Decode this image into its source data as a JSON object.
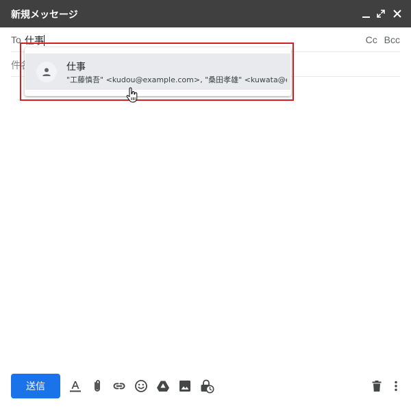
{
  "window": {
    "title": "新規メッセージ",
    "controls": [
      "minimize-icon",
      "expand-icon",
      "close-icon"
    ]
  },
  "recipients": {
    "to_label": "To",
    "to_value": "仕事",
    "cc_label": "Cc",
    "bcc_label": "Bcc"
  },
  "subject": {
    "placeholder": "件名"
  },
  "autocomplete": {
    "items": [
      {
        "name": "仕事",
        "members": "\"工藤慎吾\" <kudou@example.com>, \"桑田孝雄\" <kuwata@example.com>",
        "icon": "person-icon"
      }
    ]
  },
  "toolbar": {
    "send_label": "送信",
    "icons": [
      "format-text-icon",
      "attach-icon",
      "link-icon",
      "emoji-icon",
      "drive-icon",
      "photo-icon",
      "confidential-mode-icon",
      "trash-icon",
      "more-options-icon"
    ]
  },
  "colors": {
    "titlebar": "#404040",
    "send_button": "#1a73e8",
    "highlight_border": "#d32020",
    "suggestion_bg": "#e8eaed"
  }
}
